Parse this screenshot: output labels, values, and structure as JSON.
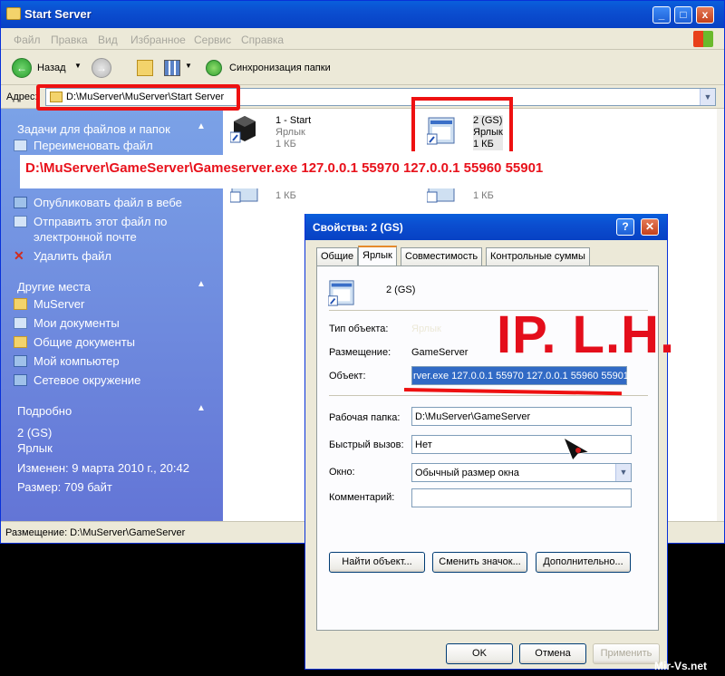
{
  "window": {
    "title": "Start Server",
    "controls": [
      "_",
      "□",
      "x"
    ]
  },
  "menu": [
    "Файл",
    "Правка",
    "Вид",
    "Избранное",
    "Сервис",
    "Справка"
  ],
  "toolbar": {
    "back_label": "Назад",
    "sync_label": "Синхронизация папки"
  },
  "address": {
    "label": "Адрес:",
    "value": "D:\\MuServer\\MuServer\\Start Server"
  },
  "taskpane": {
    "file_tasks": {
      "title": "Задачи для файлов и папок",
      "items": [
        "Переименовать файл",
        "Опубликовать файл в вебе",
        "Отправить этот файл по электронной почте",
        "Удалить файл"
      ],
      "email_line2": "электронной почте",
      "email_line1": "Отправить этот файл по"
    },
    "other_places": {
      "title": "Другие места",
      "items": [
        "MuServer",
        "Мои документы",
        "Общие документы",
        "Мой компьютер",
        "Сетевое окружение"
      ]
    },
    "details": {
      "title": "Подробно",
      "name": "2 (GS)",
      "type": "Ярлык",
      "modified": "Изменен: 9 марта 2010 г., 20:42",
      "size": "Размер: 709 байт"
    }
  },
  "files": [
    {
      "name": "1 - Start",
      "type": "Ярлык",
      "size": "1 КБ"
    },
    {
      "name": "2 (GS)",
      "type": "Ярлык",
      "size": "1 КБ"
    },
    {
      "size": "1 КБ"
    },
    {
      "size": "1 КБ"
    }
  ],
  "status": "Размещение: D:\\MuServer\\GameServer",
  "annotation": {
    "command": "D:\\MuServer\\GameServer\\Gameserver.exe 127.0.0.1 55970 127.0.0.1 55960 55901",
    "iplh": "IP. L.H."
  },
  "dialog": {
    "title": "Свойства: 2 (GS)",
    "tabs": [
      "Общие",
      "Ярлык",
      "Совместимость",
      "Контрольные суммы"
    ],
    "selected_tab": "Ярлык",
    "name": "2 (GS)",
    "type_label": "Тип объекта:",
    "type_value": "Ярлык",
    "location_label": "Размещение:",
    "location_value": "GameServer",
    "target_label": "Объект:",
    "target_value": "rver.exe 127.0.0.1 55970 127.0.0.1 55960 55901",
    "workdir_label": "Рабочая папка:",
    "workdir_value": "D:\\MuServer\\GameServer",
    "hotkey_label": "Быстрый вызов:",
    "hotkey_value": "Нет",
    "window_label": "Окно:",
    "window_value": "Обычный размер окна",
    "comment_label": "Комментарий:",
    "comment_value": "",
    "find_target": "Найти объект...",
    "change_icon": "Сменить значок...",
    "advanced": "Дополнительно...",
    "ok": "OK",
    "cancel": "Отмена",
    "apply": "Применить"
  },
  "watermark": "Mir-Vs.net"
}
